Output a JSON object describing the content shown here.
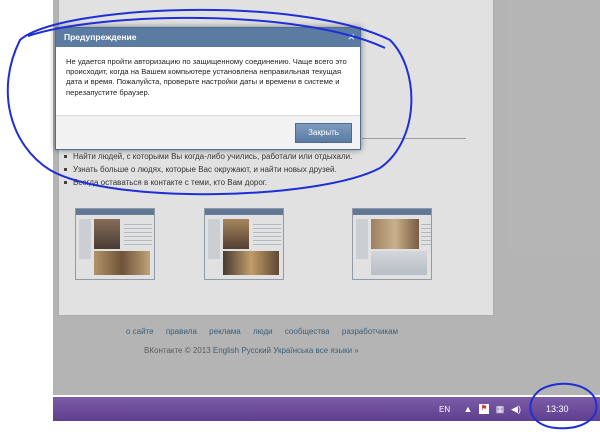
{
  "dialog": {
    "title": "Предупреждение",
    "close_icon": "close-icon",
    "message": "Не удается пройти авторизацию по защищенному соединению. Чаще всего это происходит, когда на Вашем компьютере установлена неправильная текущая дата и время. Пожалуйста, проверьте настройки даты и времени в системе и перезапустите браузер.",
    "close_button_label": "Закрыть"
  },
  "page": {
    "bullets": [
      "Найти людей, с которыми Вы когда-либо учились, работали или отдыхали.",
      "Узнать больше о людях, которые Вас окружают, и найти новых друзей.",
      "Всегда оставаться в контакте с теми, кто Вам дорог."
    ],
    "footer_links": [
      "о сайте",
      "правила",
      "реклама",
      "люди",
      "сообщества",
      "разработчикам"
    ],
    "copyright": "ВКонтакте © 2013",
    "languages": "English Русский Українська все языки »"
  },
  "taskbar": {
    "language": "EN",
    "tray_icons": [
      "arrow-up-icon",
      "flag-icon",
      "network-icon",
      "volume-icon"
    ],
    "clock": "13:30"
  },
  "colors": {
    "dialog_header": "#5b7ba3",
    "taskbar": "#6a4b9a",
    "annotation": "#1f2fd6"
  }
}
